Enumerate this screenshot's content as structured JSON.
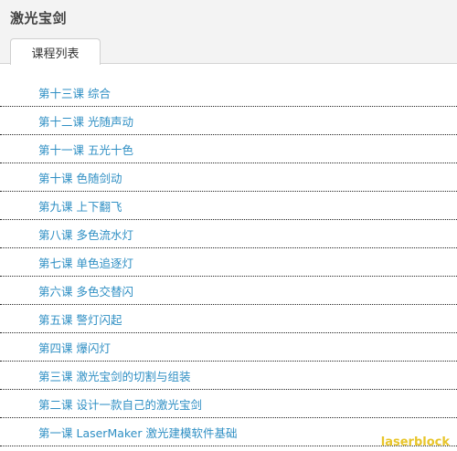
{
  "page": {
    "title": "激光宝剑"
  },
  "tabs": [
    {
      "label": "课程列表",
      "active": true
    }
  ],
  "lessons": [
    "第十三课 综合",
    "第十二课 光随声动",
    "第十一课 五光十色",
    "第十课 色随剑动",
    "第九课 上下翻飞",
    "第八课 多色流水灯",
    "第七课 单色追逐灯",
    "第六课 多色交替闪",
    "第五课 警灯闪起",
    "第四课 爆闪灯",
    "第三课 激光宝剑的切割与组装",
    "第二课 设计一款自己的激光宝剑",
    "第一课 LaserMaker 激光建模软件基础"
  ],
  "watermark": "laserblock",
  "colors": {
    "link": "#2f8fc4",
    "watermark": "#e8c52a",
    "header_bg": "#f3f3f3"
  }
}
